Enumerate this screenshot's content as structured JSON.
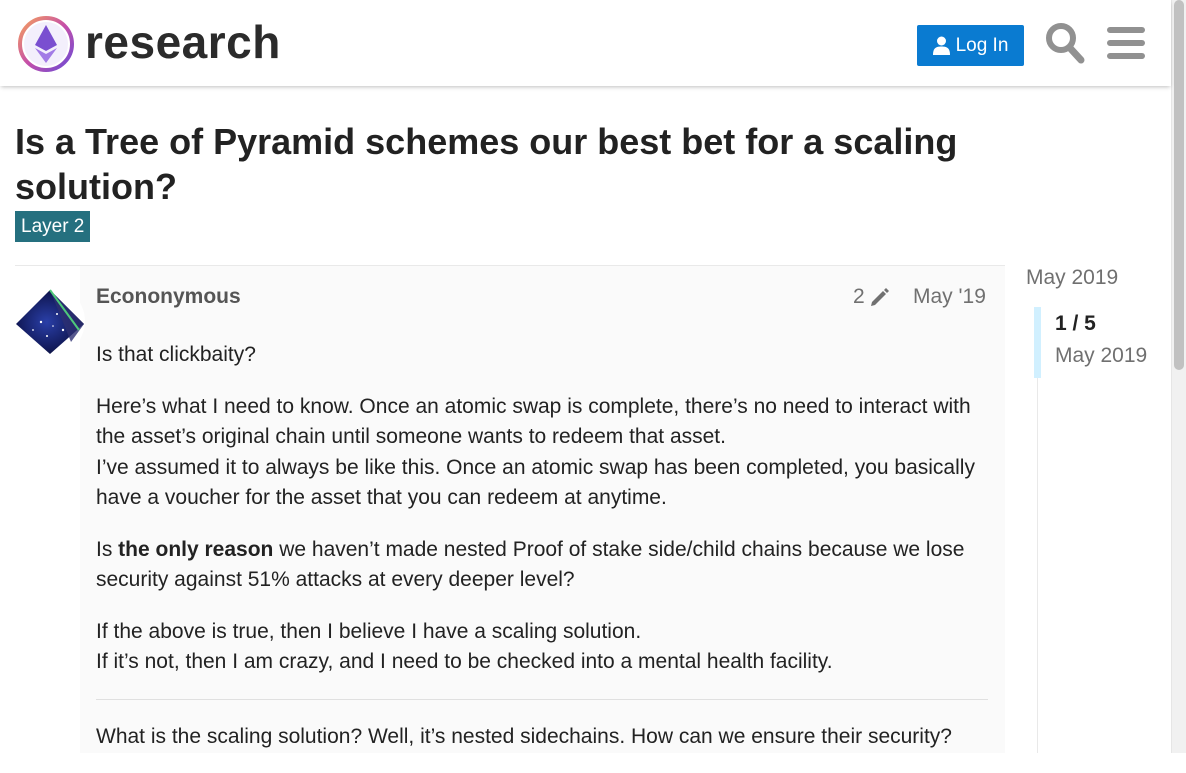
{
  "header": {
    "logo_text": "research",
    "login_label": "Log In",
    "icons": [
      "logo-icon",
      "user-icon",
      "search-icon",
      "hamburger-menu-icon"
    ],
    "login_color": "#0a7bd1"
  },
  "topic": {
    "title": "Is a Tree of Pyramid schemes our best bet for a scaling solution?",
    "category": "Layer 2",
    "category_color": "#25707f"
  },
  "post": {
    "username": "Econonymous",
    "edit_count": "2",
    "date": "May '19",
    "paragraphs": {
      "p1": "Is that clickbaity?",
      "p2_l1": "Here’s what I need to know. Once an atomic swap is complete, there’s no need to interact with the asset’s original chain until someone wants to redeem that asset.",
      "p2_l2": "I’ve assumed it to always be like this. Once an atomic swap has been completed, you basically have a voucher for the asset that you can redeem at anytime.",
      "p3_pre": "Is ",
      "p3_bold": "the only reason",
      "p3_post": " we haven’t made nested Proof of stake side/child chains because we lose security against 51% attacks at every deeper level?",
      "p4_l1": "If the above is true, then I believe I have a scaling solution.",
      "p4_l2": "If it’s not, then I am crazy, and I need to be checked into a mental health facility.",
      "p5": "What is the scaling solution? Well, it’s nested sidechains. How can we ensure their security?"
    }
  },
  "timeline": {
    "top_date": "May 2019",
    "progress": "1 / 5",
    "handle_date": "May 2019"
  }
}
